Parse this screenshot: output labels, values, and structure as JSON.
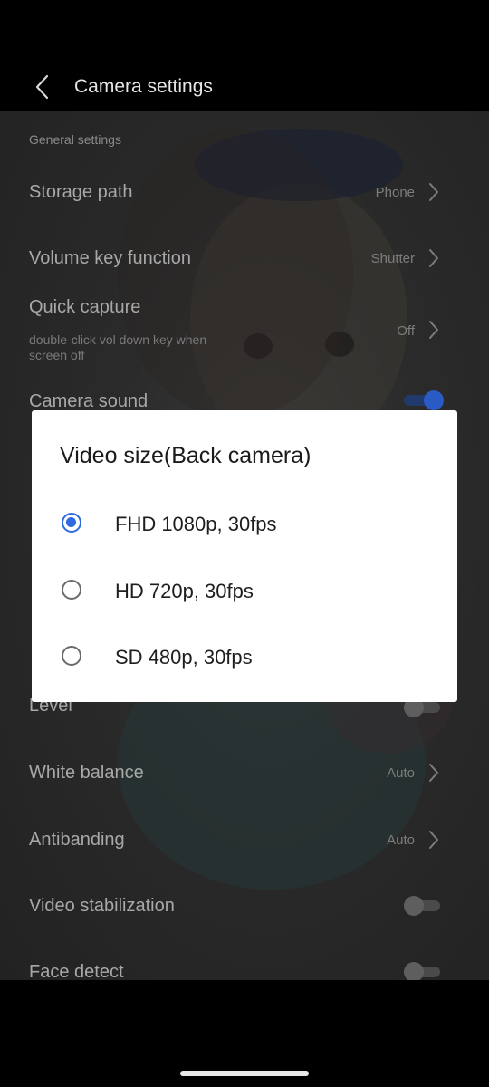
{
  "header": {
    "title": "Camera settings",
    "back_icon": "chevron-left-icon"
  },
  "settings": {
    "section_header": "General settings",
    "storage_path": {
      "label": "Storage path",
      "value": "Phone"
    },
    "volume_key": {
      "label": "Volume key function",
      "value": "Shutter"
    },
    "quick_capture": {
      "label": "Quick capture",
      "sub": "double-click vol down key when screen off",
      "value": "Off"
    },
    "camera_sound": {
      "label": "Camera sound",
      "toggle": "on"
    },
    "level": {
      "label": "Level",
      "toggle": "off"
    },
    "white_balance": {
      "label": "White balance",
      "value": "Auto"
    },
    "antibanding": {
      "label": "Antibanding",
      "value": "Auto"
    },
    "video_stabilization": {
      "label": "Video stabilization",
      "toggle": "off"
    },
    "face_detect": {
      "label": "Face detect",
      "toggle": "off"
    }
  },
  "dialog": {
    "title": "Video size(Back camera)",
    "options": [
      {
        "label": "FHD 1080p, 30fps",
        "selected": true
      },
      {
        "label": "HD 720p, 30fps",
        "selected": false
      },
      {
        "label": "SD 480p, 30fps",
        "selected": false
      }
    ]
  },
  "colors": {
    "accent": "#2f6be0",
    "background": "#000000",
    "dialog_bg": "#ffffff"
  }
}
